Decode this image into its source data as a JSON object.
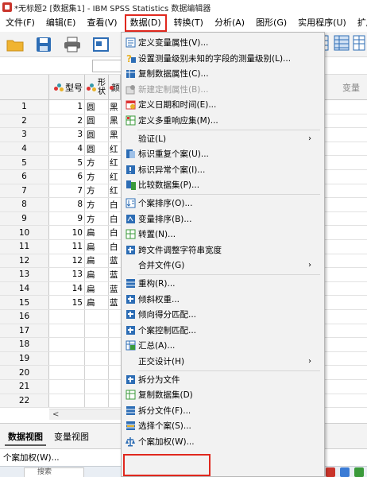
{
  "window": {
    "title": "*无标题2 [数据集1] - IBM SPSS Statistics 数据编辑器"
  },
  "menubar": {
    "items": [
      {
        "label": "文件(F)"
      },
      {
        "label": "编辑(E)"
      },
      {
        "label": "查看(V)"
      },
      {
        "label": "数据(D)"
      },
      {
        "label": "转换(T)"
      },
      {
        "label": "分析(A)"
      },
      {
        "label": "图形(G)"
      },
      {
        "label": "实用程序(U)"
      },
      {
        "label": "扩展(X)"
      }
    ]
  },
  "grid": {
    "columns": [
      {
        "name": "型号"
      },
      {
        "name_line1": "形",
        "name_line2": "状"
      },
      {
        "name": "颜"
      }
    ],
    "right_header": "变量",
    "rows": [
      {
        "n": "1",
        "c1": "1",
        "c2": "圆",
        "c3": "黑"
      },
      {
        "n": "2",
        "c1": "2",
        "c2": "圆",
        "c3": "黑"
      },
      {
        "n": "3",
        "c1": "3",
        "c2": "圆",
        "c3": "黑"
      },
      {
        "n": "4",
        "c1": "4",
        "c2": "圆",
        "c3": "红"
      },
      {
        "n": "5",
        "c1": "5",
        "c2": "方",
        "c3": "红"
      },
      {
        "n": "6",
        "c1": "6",
        "c2": "方",
        "c3": "红"
      },
      {
        "n": "7",
        "c1": "7",
        "c2": "方",
        "c3": "红"
      },
      {
        "n": "8",
        "c1": "8",
        "c2": "方",
        "c3": "白"
      },
      {
        "n": "9",
        "c1": "9",
        "c2": "方",
        "c3": "白"
      },
      {
        "n": "10",
        "c1": "10",
        "c2": "扁",
        "c3": "白"
      },
      {
        "n": "11",
        "c1": "11",
        "c2": "扁",
        "c3": "白"
      },
      {
        "n": "12",
        "c1": "12",
        "c2": "扁",
        "c3": "蓝"
      },
      {
        "n": "13",
        "c1": "13",
        "c2": "扁",
        "c3": "蓝"
      },
      {
        "n": "14",
        "c1": "14",
        "c2": "扁",
        "c3": "蓝"
      },
      {
        "n": "15",
        "c1": "15",
        "c2": "扁",
        "c3": "蓝"
      },
      {
        "n": "16",
        "c1": "",
        "c2": "",
        "c3": ""
      },
      {
        "n": "17",
        "c1": "",
        "c2": "",
        "c3": ""
      },
      {
        "n": "18",
        "c1": "",
        "c2": "",
        "c3": ""
      },
      {
        "n": "19",
        "c1": "",
        "c2": "",
        "c3": ""
      },
      {
        "n": "20",
        "c1": "",
        "c2": "",
        "c3": ""
      },
      {
        "n": "21",
        "c1": "",
        "c2": "",
        "c3": ""
      },
      {
        "n": "22",
        "c1": "",
        "c2": "",
        "c3": ""
      }
    ]
  },
  "tabs": {
    "data_view": "数据视图",
    "variable_view": "变量视图"
  },
  "status": {
    "text": "个案加权(W)..."
  },
  "taskbar": {
    "search_text": "搜索"
  },
  "menu": {
    "items": [
      {
        "label": "定义变量属性(V)...",
        "icon": "define-variable-properties-icon",
        "disabled": false
      },
      {
        "label": "设置测量级别未知的字段的测量级别(L)...",
        "icon": "set-measurement-level-icon",
        "disabled": false
      },
      {
        "label": "复制数据属性(C)...",
        "icon": "copy-data-properties-icon",
        "disabled": false
      },
      {
        "label": "新建定制属性(B)...",
        "icon": "new-custom-attribute-icon",
        "disabled": true
      },
      {
        "label": "定义日期和时间(E)...",
        "icon": "define-dates-icon",
        "disabled": false
      },
      {
        "label": "定义多重响应集(M)...",
        "icon": "multiple-response-icon",
        "disabled": false
      },
      {
        "label": "验证(L)",
        "icon": "",
        "disabled": false,
        "submenu": true
      },
      {
        "label": "标识重复个案(U)...",
        "icon": "identify-duplicates-icon",
        "disabled": false
      },
      {
        "label": "标识异常个案(I)...",
        "icon": "identify-unusual-icon",
        "disabled": false
      },
      {
        "label": "比较数据集(P)...",
        "icon": "compare-datasets-icon",
        "disabled": false
      },
      {
        "label": "个案排序(O)...",
        "icon": "sort-cases-icon",
        "disabled": false
      },
      {
        "label": "变量排序(B)...",
        "icon": "sort-variables-icon",
        "disabled": false
      },
      {
        "label": "转置(N)...",
        "icon": "transpose-icon",
        "disabled": false
      },
      {
        "label": "跨文件调整字符串宽度",
        "icon": "adjust-string-width-icon",
        "disabled": false
      },
      {
        "label": "合并文件(G)",
        "icon": "",
        "disabled": false,
        "submenu": true
      },
      {
        "label": "重构(R)...",
        "icon": "restructure-icon",
        "disabled": false
      },
      {
        "label": "倾斜权重...",
        "icon": "rake-weights-icon",
        "disabled": false
      },
      {
        "label": "倾向得分匹配...",
        "icon": "propensity-matching-icon",
        "disabled": false
      },
      {
        "label": "个案控制匹配...",
        "icon": "case-control-icon",
        "disabled": false
      },
      {
        "label": "汇总(A)...",
        "icon": "aggregate-icon",
        "disabled": false
      },
      {
        "label": "正交设计(H)",
        "icon": "",
        "disabled": false,
        "submenu": true
      },
      {
        "label": "拆分为文件",
        "icon": "split-into-files-icon",
        "disabled": false
      },
      {
        "label": "复制数据集(D)",
        "icon": "copy-dataset-icon",
        "disabled": false
      },
      {
        "label": "拆分文件(F)...",
        "icon": "split-file-icon",
        "disabled": false
      },
      {
        "label": "选择个案(S)...",
        "icon": "select-cases-icon",
        "disabled": false
      },
      {
        "label": "个案加权(W)...",
        "icon": "weight-cases-icon",
        "disabled": false
      }
    ],
    "submenu_arrow": "›"
  },
  "colors": {
    "highlight": "#e0281e",
    "icon_blue": "#2d6db5",
    "icon_green": "#3a9a3a"
  }
}
